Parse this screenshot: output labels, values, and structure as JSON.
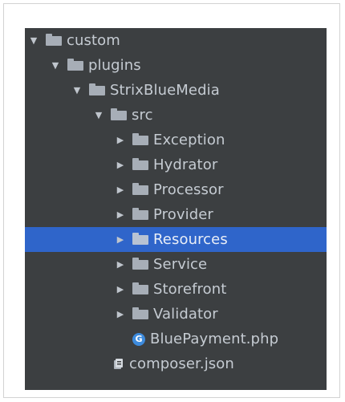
{
  "tree": {
    "items": [
      {
        "label": "custom",
        "expanded": true,
        "type": "folder"
      },
      {
        "label": "plugins",
        "expanded": true,
        "type": "folder"
      },
      {
        "label": "StrixBlueMedia",
        "expanded": true,
        "type": "folder"
      },
      {
        "label": "src",
        "expanded": true,
        "type": "folder"
      },
      {
        "label": "Exception",
        "expanded": false,
        "type": "folder"
      },
      {
        "label": "Hydrator",
        "expanded": false,
        "type": "folder"
      },
      {
        "label": "Processor",
        "expanded": false,
        "type": "folder"
      },
      {
        "label": "Provider",
        "expanded": false,
        "type": "folder"
      },
      {
        "label": "Resources",
        "expanded": false,
        "type": "folder",
        "selected": true
      },
      {
        "label": "Service",
        "expanded": false,
        "type": "folder"
      },
      {
        "label": "Storefront",
        "expanded": false,
        "type": "folder"
      },
      {
        "label": "Validator",
        "expanded": false,
        "type": "folder"
      },
      {
        "label": "BluePayment.php",
        "type": "php-file",
        "icon_glyph": "G"
      },
      {
        "label": "composer.json",
        "type": "json-file"
      }
    ]
  },
  "colors": {
    "panel_bg": "#3c3f41",
    "selection": "#2f65ca",
    "php_icon": "#3d8bdd",
    "text": "#c5cbd2"
  },
  "icons": {
    "expanded": "arrow-down-icon",
    "collapsed": "arrow-right-icon",
    "folder": "folder-icon",
    "php": "php-file-icon",
    "json": "json-file-icon"
  }
}
